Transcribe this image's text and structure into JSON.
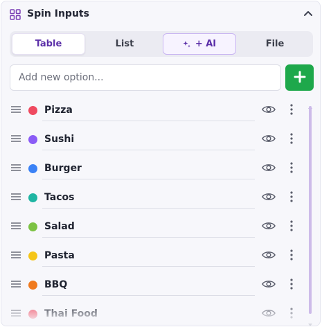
{
  "panel": {
    "title": "Spin Inputs",
    "header_icon": "grid-icon",
    "collapse_icon": "chevron-up-icon"
  },
  "tabs": [
    {
      "label": "Table",
      "active": true
    },
    {
      "label": "List",
      "active": false
    },
    {
      "label": "+ AI",
      "icon": "sparkle-icon",
      "active": false
    },
    {
      "label": "File",
      "active": false
    }
  ],
  "add_option": {
    "placeholder": "Add new option...",
    "value": "",
    "button_icon": "plus-icon"
  },
  "options": [
    {
      "label": "Pizza",
      "color": "#ef4a60"
    },
    {
      "label": "Sushi",
      "color": "#8b5cf6"
    },
    {
      "label": "Burger",
      "color": "#3b82f6"
    },
    {
      "label": "Tacos",
      "color": "#1fb5a3"
    },
    {
      "label": "Salad",
      "color": "#7cc243"
    },
    {
      "label": "Pasta",
      "color": "#f5c518"
    },
    {
      "label": "BBQ",
      "color": "#f07a1e"
    },
    {
      "label": "Thai Food",
      "color": "#ef4a60"
    }
  ],
  "colors": {
    "accent": "#5b2fa8",
    "add_button": "#1ea84b",
    "scroll_thumb": "#cdbbe9"
  }
}
